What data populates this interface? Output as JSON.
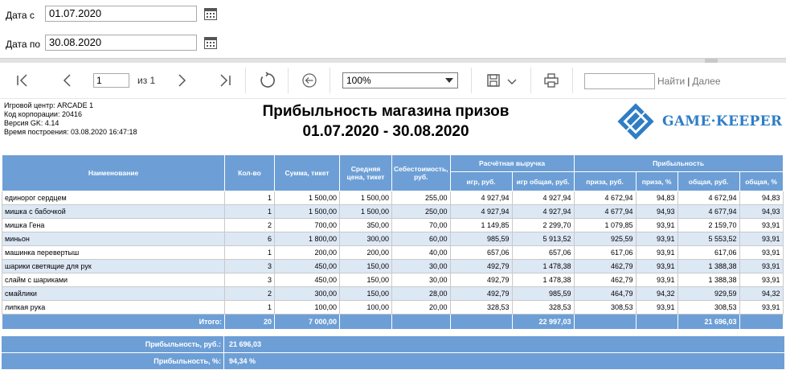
{
  "filters": {
    "date_from_label": "Дата с",
    "date_from_value": "01.07.2020",
    "date_to_label": "Дата по",
    "date_to_value": "30.08.2020"
  },
  "toolbar": {
    "page_current": "1",
    "page_of": "из 1",
    "zoom": "100%",
    "find_label": "Найти",
    "find_separator": "|",
    "next_label": "Далее"
  },
  "report": {
    "meta": [
      "Игровой центр: ARCADE 1",
      "Код корпорации: 20416",
      "Версия GK: 4.14",
      "Время построения: 03.08.2020 16:47:18"
    ],
    "title_line1": "Прибыльность магазина призов",
    "title_line2": "01.07.2020 - 30.08.2020",
    "logo_text": "GAME·KEEPER",
    "headers": {
      "name": "Наименование",
      "qty": "Кол-во",
      "sum_ticket": "Сумма, тикет",
      "avg_price": "Средняя цена, тикет",
      "cost": "Себестоимость, руб.",
      "calc_revenue": "Расчётная выручка",
      "rev_game": "игр, руб.",
      "rev_total": "игр общая, руб.",
      "profit": "Прибыльность",
      "p_prize_rub": "приза, руб.",
      "p_prize_pct": "приза, %",
      "p_total_rub": "общая, руб.",
      "p_total_pct": "общая, %"
    },
    "rows": [
      [
        "единорог сердцем",
        "1",
        "1 500,00",
        "1 500,00",
        "255,00",
        "4 927,94",
        "4 927,94",
        "4 672,94",
        "94,83",
        "4 672,94",
        "94,83"
      ],
      [
        "мишка с бабочкой",
        "1",
        "1 500,00",
        "1 500,00",
        "250,00",
        "4 927,94",
        "4 927,94",
        "4 677,94",
        "94,93",
        "4 677,94",
        "94,93"
      ],
      [
        "мишка Гена",
        "2",
        "700,00",
        "350,00",
        "70,00",
        "1 149,85",
        "2 299,70",
        "1 079,85",
        "93,91",
        "2 159,70",
        "93,91"
      ],
      [
        "миньон",
        "6",
        "1 800,00",
        "300,00",
        "60,00",
        "985,59",
        "5 913,52",
        "925,59",
        "93,91",
        "5 553,52",
        "93,91"
      ],
      [
        "машинка перевертыш",
        "1",
        "200,00",
        "200,00",
        "40,00",
        "657,06",
        "657,06",
        "617,06",
        "93,91",
        "617,06",
        "93,91"
      ],
      [
        "шарики светящие для рук",
        "3",
        "450,00",
        "150,00",
        "30,00",
        "492,79",
        "1 478,38",
        "462,79",
        "93,91",
        "1 388,38",
        "93,91"
      ],
      [
        "слайм с шариками",
        "3",
        "450,00",
        "150,00",
        "30,00",
        "492,79",
        "1 478,38",
        "462,79",
        "93,91",
        "1 388,38",
        "93,91"
      ],
      [
        "смайлики",
        "2",
        "300,00",
        "150,00",
        "28,00",
        "492,79",
        "985,59",
        "464,79",
        "94,32",
        "929,59",
        "94,32"
      ],
      [
        "липкая рука",
        "1",
        "100,00",
        "100,00",
        "20,00",
        "328,53",
        "328,53",
        "308,53",
        "93,91",
        "308,53",
        "93,91"
      ]
    ],
    "total": {
      "label": "Итого:",
      "qty": "20",
      "sum_ticket": "7 000,00",
      "rev_total": "22 997,03",
      "p_total_rub": "21 696,03"
    },
    "summary_profit_rub_label": "Прибыльность, руб.:",
    "summary_profit_rub_value": "21 696,03",
    "summary_profit_pct_label": "Прибыльность, %:",
    "summary_profit_pct_value": "94,34 %"
  }
}
